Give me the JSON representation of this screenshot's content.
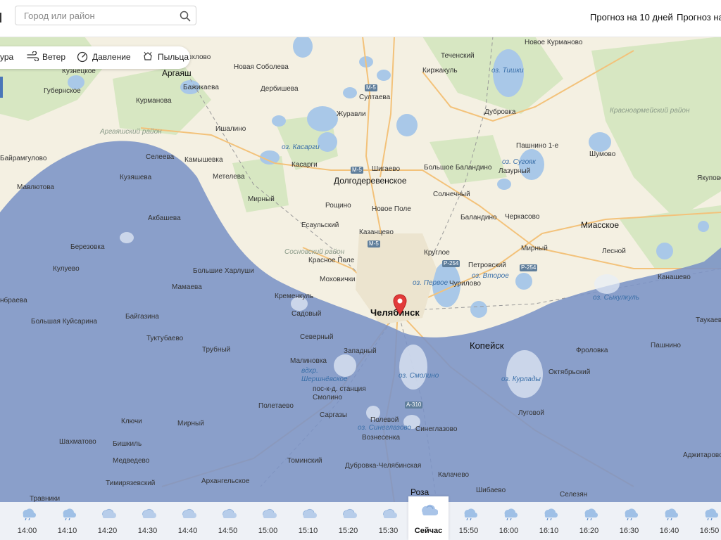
{
  "header": {
    "search_placeholder": "Город или район",
    "forecast_10_days": "Прогноз на 10 дней",
    "forecast_partial": "Прогноз на"
  },
  "layers": [
    {
      "label": "ура",
      "icon": "temperature-icon"
    },
    {
      "label": "Ветер",
      "icon": "wind-icon"
    },
    {
      "label": "Давление",
      "icon": "pressure-gauge-icon"
    },
    {
      "label": "Пыльца",
      "icon": "pollen-icon"
    }
  ],
  "map": {
    "colors": {
      "land": "#f4f0e2",
      "forest": "#d6e6c0",
      "water": "#a9c8e8",
      "precip": "#7b93c6"
    },
    "labels": {
      "argayash": "Аргаяш",
      "kuznetskoe": "Кузнецкое",
      "gubernskoe": "Губернское",
      "kurmanova": "Курманова",
      "argayash_rayon": "Аргаяшский район",
      "bairamgulovo": "Байрамгулово",
      "mavlyutova": "Мавлютова",
      "seleeva": "Селеева",
      "kamyshevka": "Камышевка",
      "kuzyasheva": "Кузяшева",
      "akbasheva": "Акбашева",
      "berezovka": "Березовка",
      "kuluevo": "Кулуево",
      "bolshie_kharlushi": "Большие Харлуши",
      "mamaeva": "Мамаева",
      "ibrahima": "нбраева",
      "bolshaya_kuisarina": "Большая Куйсарина",
      "baigazina": "Байгазина",
      "tuktubaevo": "Туктубаево",
      "trubny": "Трубный",
      "klyuchi": "Ключи",
      "shakhmatovo": "Шахматово",
      "bishkil": "Бишкиль",
      "medvedevo": "Медведево",
      "timiryazevsky": "Тимирязевский",
      "travniki": "Травники",
      "mirny_sw": "Мирный",
      "arkhangelskoe": "Архангельское",
      "tominsky": "Томинский",
      "dubrovka_chel": "Дубровка-Челябинская",
      "roza": "Роза",
      "khokhlovo": "Хохлово",
      "bazhikaeva": "Бажикаева",
      "ishalino": "Ишалино",
      "meteleva": "Метелева",
      "mirny": "Мирный",
      "kasargi": "Касарги",
      "oz_kasargi": "оз. Касарги",
      "nova_soboleva": "Новая Соболева",
      "derbisheva": "Дербишева",
      "sultaeva": "Султаева",
      "zhuravli": "Журавли",
      "shigaevo": "Шигаево",
      "dolgoderevenskoe": "Долгодеревенское",
      "roshchino": "Рощино",
      "novoe_pole": "Новое Поле",
      "esaulsky": "Есаульский",
      "kazantsevo": "Казанцево",
      "sosnovsky_rayon": "Сосновский район",
      "krasnoe_pole": "Красное Поле",
      "mokhovichi": "Моховички",
      "kremenkul": "Кременкуль",
      "sadovy": "Садовый",
      "chelyabinsk": "Челябинск",
      "severny": "Северный",
      "zapadny": "Западный",
      "malinovka": "Малиновка",
      "vdkhr": "вдхр. Шершнёвское",
      "smolino_posyolok": "пос-к-д. станция Смолино",
      "oz_smolino": "оз. Смолино",
      "sargazy": "Саргазы",
      "poletaevo": "Полетаево",
      "polevoy": "Полевой",
      "oz_sinegladovo": "оз. Синеглазово",
      "voznesenka": "Вознесенка",
      "sinegl": "Синеглазово",
      "kalachevo": "Калачево",
      "shibaevo": "Шибаево",
      "teshensky": "Теченский",
      "kirzhakul": "Киржакуль",
      "novoe_kurmanovo": "Новое Курманово",
      "oz_tishki": "оз. Тишки",
      "dubrovka": "Дубровка",
      "krasnoarm_rayon": "Красноармейский район",
      "pashnino1": "Пашнино 1-е",
      "oz_sugoyak": "оз. Сугояк",
      "lazurny": "Лазурный",
      "shumovo": "Шумово",
      "yakupovo": "Якупово",
      "bolshoe_balandino": "Большое Баландино",
      "solnechny": "Солнечный",
      "balandino": "Баландино",
      "cherkasovo": "Черкасово",
      "miasskoe": "Миасское",
      "mirny_e": "Мирный",
      "lesnoy": "Лесной",
      "kruglo": "Круглое",
      "petrovsky": "Петровский",
      "oz_pervoe": "оз. Первое",
      "chirilovo": "Чурилово",
      "oz_vtoroe": "оз. Второе",
      "kanasheva": "Канашево",
      "oz_sykonkul": "оз. Сыкулкуль",
      "kopeisk": "Копейск",
      "frolovka": "Фроловка",
      "oktyabrsky": "Октябрьский",
      "pashnino": "Пашнино",
      "taukaevo": "Таукаево",
      "oz_kuryady": "оз. Курлады",
      "lugovoy": "Луговой",
      "azhitarovo": "Аджитарово",
      "selezyan": "Селезян",
      "m5": "М-5",
      "r254": "Р-254",
      "a310": "А-310"
    }
  },
  "timeline": [
    {
      "time": "14:00",
      "icon": "rain-cloud-icon",
      "now": false
    },
    {
      "time": "14:10",
      "icon": "rain-cloud-icon",
      "now": false
    },
    {
      "time": "14:20",
      "icon": "snow-cloud-icon",
      "now": false
    },
    {
      "time": "14:30",
      "icon": "snow-cloud-icon",
      "now": false
    },
    {
      "time": "14:40",
      "icon": "snow-cloud-icon",
      "now": false
    },
    {
      "time": "14:50",
      "icon": "snow-cloud-icon",
      "now": false
    },
    {
      "time": "15:00",
      "icon": "snow-cloud-icon",
      "now": false
    },
    {
      "time": "15:10",
      "icon": "snow-cloud-icon",
      "now": false
    },
    {
      "time": "15:20",
      "icon": "snow-cloud-icon",
      "now": false
    },
    {
      "time": "15:30",
      "icon": "snow-cloud-icon",
      "now": false
    },
    {
      "time": "Сейчас",
      "icon": "cloud-icon",
      "now": true
    },
    {
      "time": "15:50",
      "icon": "rain-cloud-icon",
      "now": false
    },
    {
      "time": "16:00",
      "icon": "rain-cloud-icon",
      "now": false
    },
    {
      "time": "16:10",
      "icon": "rain-cloud-icon",
      "now": false
    },
    {
      "time": "16:20",
      "icon": "rain-cloud-icon",
      "now": false
    },
    {
      "time": "16:30",
      "icon": "rain-cloud-icon",
      "now": false
    },
    {
      "time": "16:40",
      "icon": "rain-cloud-icon",
      "now": false
    },
    {
      "time": "16:50",
      "icon": "rain-cloud-icon",
      "now": false
    }
  ]
}
